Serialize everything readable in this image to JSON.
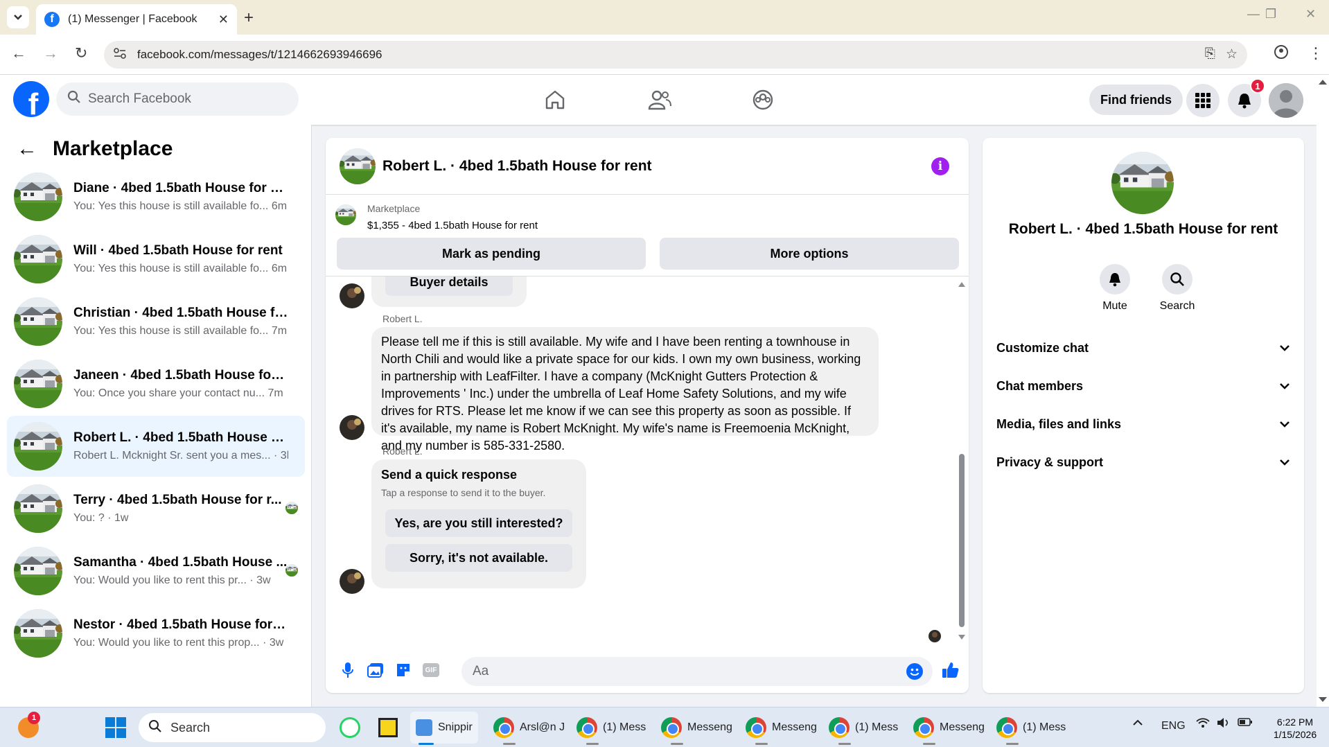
{
  "browser": {
    "tab_title": "(1) Messenger | Facebook",
    "new_tab": "+",
    "url": "facebook.com/messages/t/1214662693946696"
  },
  "fb": {
    "search_placeholder": "Search Facebook",
    "find_friends": "Find friends",
    "notification_count": "1",
    "brand_color": "#0866ff"
  },
  "sidebar": {
    "title": "Marketplace",
    "conversations": [
      {
        "name": "Diane · 4bed 1.5bath House for rent",
        "preview": "You: Yes this house is still available fo...",
        "time": "6m"
      },
      {
        "name": "Will · 4bed 1.5bath House for rent",
        "preview": "You: Yes this house is still available fo...",
        "time": "6m"
      },
      {
        "name": "Christian · 4bed 1.5bath House for ...",
        "preview": "You: Yes this house is still available fo...",
        "time": "7m"
      },
      {
        "name": "Janeen · 4bed 1.5bath House for re...",
        "preview": "You: Once you share your contact nu...",
        "time": "7m"
      },
      {
        "name": "Robert L. · 4bed 1.5bath House for...",
        "preview": "Robert L. Mcknight Sr. sent you a mes...",
        "time": "· 3h"
      },
      {
        "name": "Terry · 4bed 1.5bath House for r...",
        "preview": "You: ? · 1w",
        "time": ""
      },
      {
        "name": "Samantha · 4bed 1.5bath House ...",
        "preview": "You: Would you like to rent this pr...",
        "time": "· 3w"
      },
      {
        "name": "Nestor · 4bed 1.5bath House for re...",
        "preview": "You: Would you like to rent this prop...",
        "time": "· 3w"
      }
    ]
  },
  "chat": {
    "title": "Robert L. · 4bed 1.5bath House for rent",
    "marketplace_label": "Marketplace",
    "listing": "$1,355 - 4bed 1.5bath House for rent",
    "mark_pending": "Mark as pending",
    "more_options": "More options",
    "buyer_details": "Buyer details",
    "sender": "Robert L.",
    "message": "Please tell me if this is still available. My wife and I have been renting a townhouse in North Chili and would like a private space for our kids. I own my own business, working in partnership with LeafFilter. I have a company (McKnight Gutters Protection & Improvements ' Inc.) under the umbrella of Leaf Home Safety Solutions, and my wife drives for RTS. Please let me know if we can see this property as soon as possible. If it's available, my name is Robert McKnight. My wife's name is Freemoenia McKnight, and my number is 585-331-2580.",
    "quick_title": "Send a quick response",
    "quick_sub": "Tap a response to send it to the buyer.",
    "quick_1": "Yes, are you still interested?",
    "quick_2": "Sorry, it's not available.",
    "input_placeholder": "Aa",
    "gif": "GIF"
  },
  "details": {
    "name": "Robert L. · 4bed 1.5bath House for rent",
    "mute": "Mute",
    "search": "Search",
    "sections": [
      "Customize chat",
      "Chat members",
      "Media, files and links",
      "Privacy & support"
    ]
  },
  "taskbar": {
    "search": "Search",
    "badge": "1",
    "items": [
      "Snippir",
      "Arsl@n J",
      "(1) Mess",
      "Messeng",
      "Messeng",
      "(1) Mess",
      "Messeng",
      "(1) Mess"
    ],
    "lang": "ENG",
    "time": "6:22 PM",
    "date": "1/15/2026"
  }
}
